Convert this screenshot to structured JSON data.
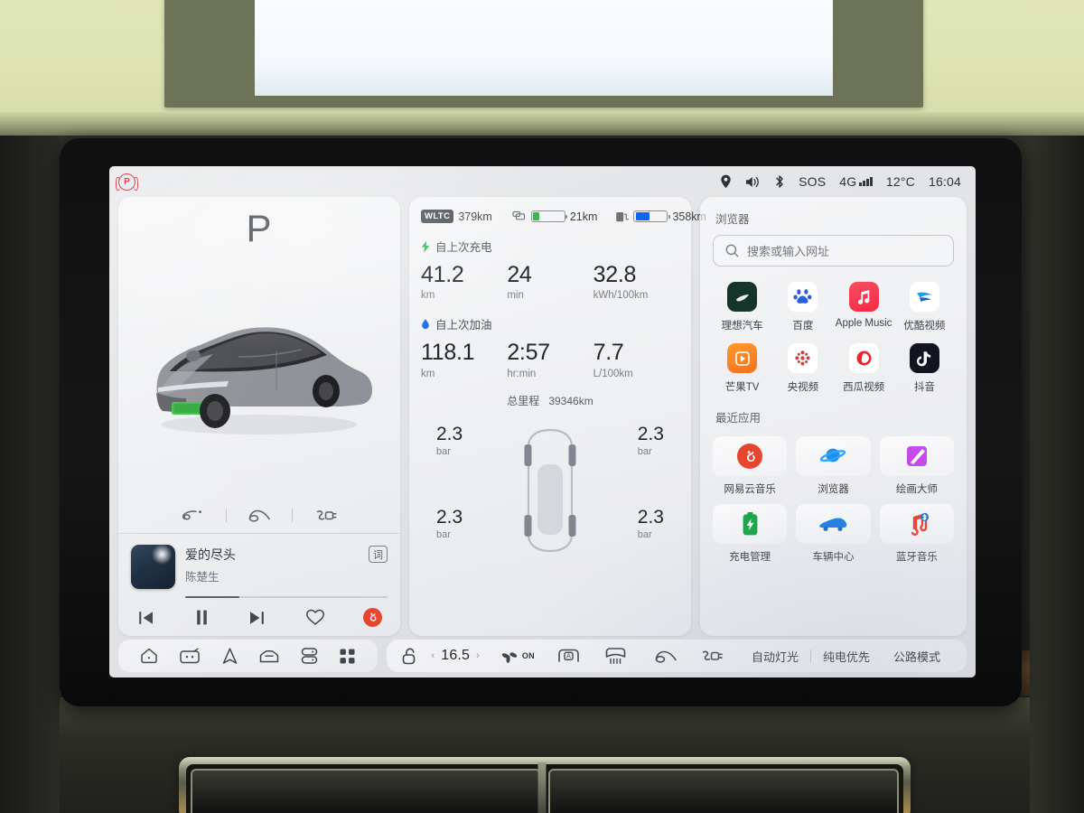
{
  "status_bar": {
    "parking_brake": "P",
    "icons": [
      "location-icon",
      "volume-icon",
      "bluetooth-icon"
    ],
    "sos": "SOS",
    "network": "4G",
    "temperature": "12°C",
    "time": "16:04"
  },
  "vehicle_panel": {
    "gear": "P",
    "quick_icons": [
      "fuel-cap-icon",
      "trunk-icon",
      "charge-port-icon"
    ],
    "player": {
      "title": "爱的尽头",
      "artist": "陈楚生",
      "lyrics_label": "词",
      "progress_percent": 27,
      "controls": [
        "previous-icon",
        "pause-icon",
        "next-icon",
        "favorite-icon",
        "netease-icon"
      ]
    }
  },
  "trip_panel": {
    "wltc_badge": "WLTC",
    "wltc_range": "379km",
    "battery_range": "21km",
    "battery_percent": 20,
    "battery_color": "#35b34a",
    "fuel_range": "358km",
    "fuel_percent": 45,
    "fuel_color": "#1264f0",
    "since_charge": {
      "label": "自上次充电",
      "icon": "lightning-icon",
      "stats": [
        {
          "value": "41.2",
          "unit": "km"
        },
        {
          "value": "24",
          "unit": "min"
        },
        {
          "value": "32.8",
          "unit": "kWh/100km"
        }
      ]
    },
    "since_refuel": {
      "label": "自上次加油",
      "icon": "fuel-drop-icon",
      "stats": [
        {
          "value": "118.1",
          "unit": "km"
        },
        {
          "value": "2:57",
          "unit": "hr:min"
        },
        {
          "value": "7.7",
          "unit": "L/100km"
        }
      ]
    },
    "odometer_label": "总里程",
    "odometer_value": "39346km",
    "tire_pressure": {
      "unit": "bar",
      "front_left": "2.3",
      "front_right": "2.3",
      "rear_left": "2.3",
      "rear_right": "2.3"
    }
  },
  "apps_panel": {
    "browser_label": "浏览器",
    "search_placeholder": "搜索或输入网址",
    "shortcuts": [
      {
        "name": "理想汽车",
        "icon": "li-auto-icon",
        "bg": "#1d3b30"
      },
      {
        "name": "百度",
        "icon": "baidu-icon",
        "bg": "#ffffff"
      },
      {
        "name": "Apple Music",
        "icon": "apple-music-icon",
        "bg": "#fa2d48"
      },
      {
        "name": "优酷视频",
        "icon": "youku-icon",
        "bg": "#ffffff"
      },
      {
        "name": "芒果TV",
        "icon": "mangotv-icon",
        "bg": "#f5822a"
      },
      {
        "name": "央视频",
        "icon": "yangshipin-icon",
        "bg": "#ffffff"
      },
      {
        "name": "西瓜视频",
        "icon": "xigua-icon",
        "bg": "#ffffff"
      },
      {
        "name": "抖音",
        "icon": "douyin-icon",
        "bg": "#161823"
      }
    ],
    "recent_label": "最近应用",
    "recent": [
      {
        "name": "网易云音乐",
        "icon": "netease-music-icon"
      },
      {
        "name": "浏览器",
        "icon": "browser-planet-icon"
      },
      {
        "name": "绘画大师",
        "icon": "paint-master-icon"
      },
      {
        "name": "充电管理",
        "icon": "charging-battery-icon"
      },
      {
        "name": "车辆中心",
        "icon": "vehicle-center-icon"
      },
      {
        "name": "蓝牙音乐",
        "icon": "bluetooth-music-icon"
      }
    ]
  },
  "dock": {
    "left_icons": [
      "home-icon",
      "media-icon",
      "navigation-icon",
      "vehicle-icon",
      "seats-icon",
      "apps-grid-icon"
    ],
    "climate": {
      "lock_icon": "unlock-icon",
      "decrease": "‹",
      "temperature": "16.5",
      "increase": "›",
      "fan_icon": "fan-icon",
      "fan_state": "ON",
      "auto_icon": "auto-ac-icon",
      "defrost_icon": "defrost-icon"
    },
    "right_icons": [
      "fuel-cap-icon",
      "trunk-icon",
      "charge-port-icon"
    ],
    "modes": [
      "自动灯光",
      "纯电优先",
      "公路模式"
    ]
  }
}
